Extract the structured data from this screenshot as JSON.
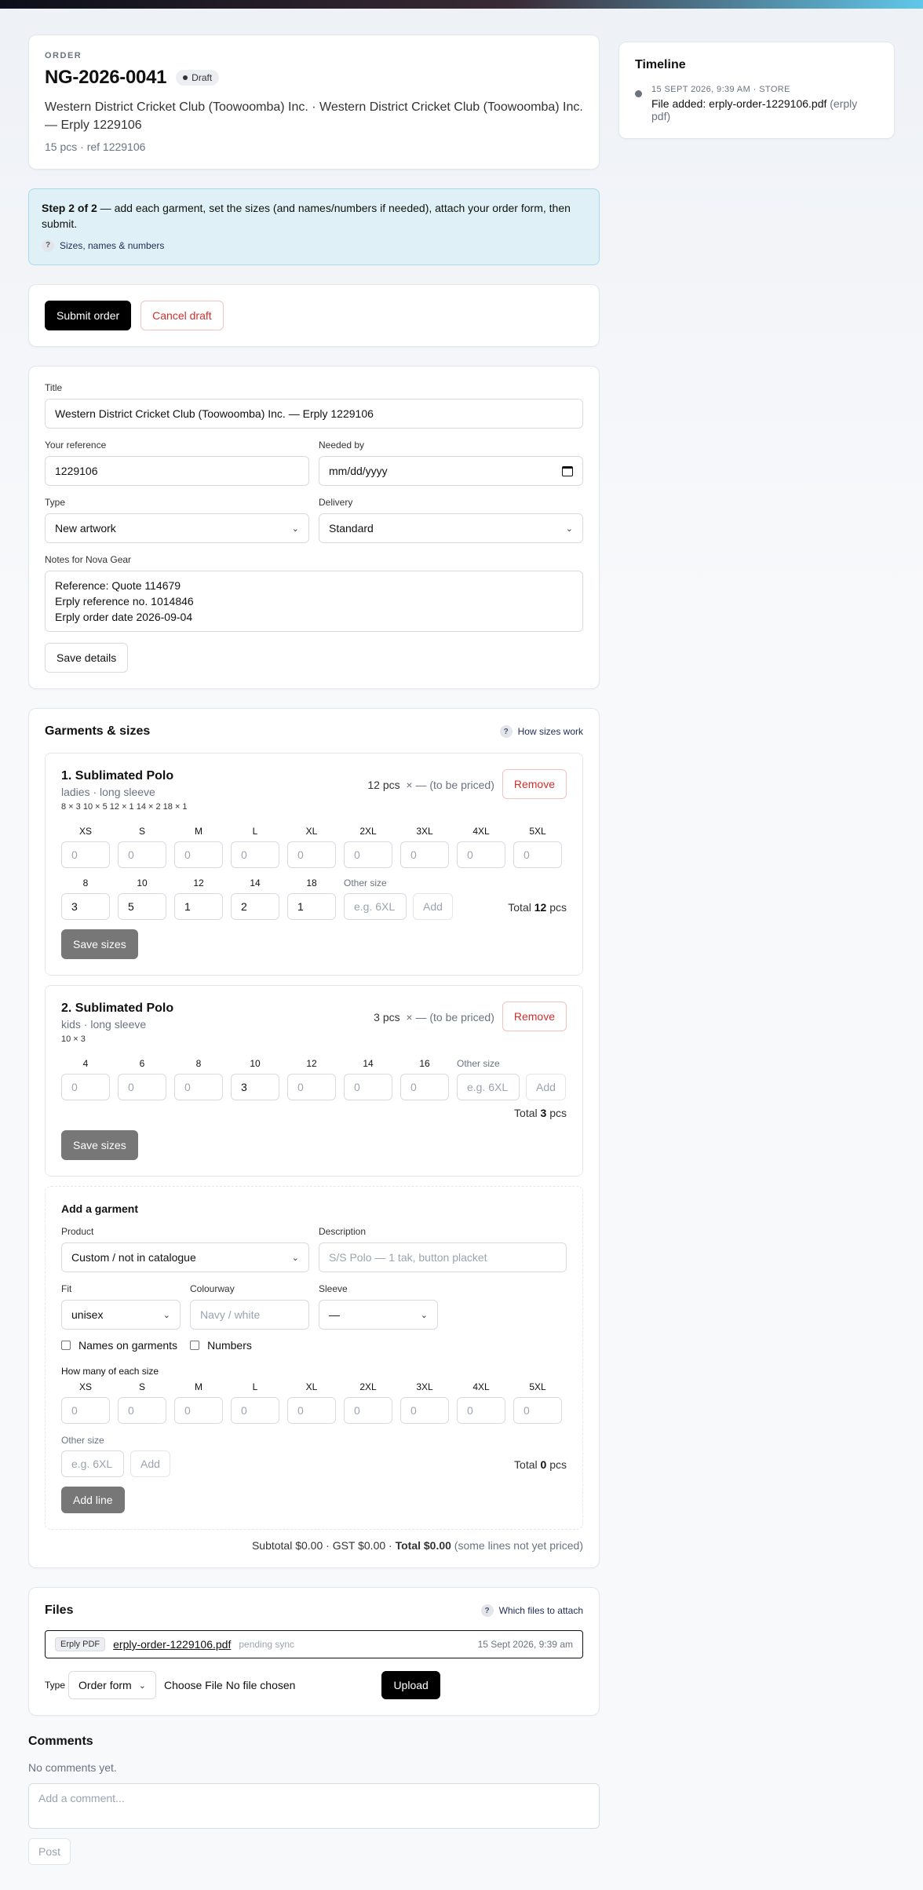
{
  "header": {
    "eyebrow": "ORDER",
    "order_no": "NG-2026-0041",
    "status": "Draft",
    "subtitle": "Western District Cricket Club (Toowoomba) Inc. · Western District Cricket Club (Toowoomba) Inc. — Erply 1229106",
    "meta": "15 pcs · ref 1229106"
  },
  "step": {
    "bold": "Step 2 of 2",
    "text": " — add each garment, set the sizes (and names/numbers if needed), attach your order form, then submit.",
    "help": "Sizes, names & numbers"
  },
  "actions": {
    "submit": "Submit order",
    "cancel": "Cancel draft"
  },
  "details": {
    "title_label": "Title",
    "title_value": "Western District Cricket Club (Toowoomba) Inc. — Erply 1229106",
    "ref_label": "Your reference",
    "ref_value": "1229106",
    "needed_label": "Needed by",
    "needed_placeholder": "mm/dd/yyyy",
    "type_label": "Type",
    "type_value": "New artwork",
    "delivery_label": "Delivery",
    "delivery_value": "Standard",
    "notes_label": "Notes for Nova Gear",
    "notes_value": "Reference: Quote 114679\nErply reference no. 1014846\nErply order date 2026-09-04",
    "save": "Save details"
  },
  "garments": {
    "title": "Garments & sizes",
    "help": "How sizes work",
    "items": [
      {
        "name": "1. Sublimated Polo",
        "sub": "ladies · long sleeve",
        "summary": "8 × 3 10 × 5 12 × 1 14 × 2 18 × 1",
        "qty": "12 pcs",
        "price": "× — (to be priced)",
        "remove": "Remove",
        "sizes": [
          {
            "label": "XS",
            "value": "0",
            "set": false
          },
          {
            "label": "S",
            "value": "0",
            "set": false
          },
          {
            "label": "M",
            "value": "0",
            "set": false
          },
          {
            "label": "L",
            "value": "0",
            "set": false
          },
          {
            "label": "XL",
            "value": "0",
            "set": false
          },
          {
            "label": "2XL",
            "value": "0",
            "set": false
          },
          {
            "label": "3XL",
            "value": "0",
            "set": false
          },
          {
            "label": "4XL",
            "value": "0",
            "set": false
          },
          {
            "label": "5XL",
            "value": "0",
            "set": false
          }
        ],
        "extra_sizes": [
          {
            "label": "8",
            "value": "3"
          },
          {
            "label": "10",
            "value": "5"
          },
          {
            "label": "12",
            "value": "1"
          },
          {
            "label": "14",
            "value": "2"
          },
          {
            "label": "18",
            "value": "1"
          }
        ],
        "other_label": "Other size",
        "other_placeholder": "e.g. 6XL",
        "add": "Add",
        "total_label": "Total",
        "total_value": "12",
        "total_unit": "pcs",
        "save": "Save sizes"
      },
      {
        "name": "2. Sublimated Polo",
        "sub": "kids · long sleeve",
        "summary": "10 × 3",
        "qty": "3 pcs",
        "price": "× — (to be priced)",
        "remove": "Remove",
        "sizes": [
          {
            "label": "4",
            "value": "0",
            "set": false
          },
          {
            "label": "6",
            "value": "0",
            "set": false
          },
          {
            "label": "8",
            "value": "0",
            "set": false
          },
          {
            "label": "10",
            "value": "3",
            "set": true
          },
          {
            "label": "12",
            "value": "0",
            "set": false
          },
          {
            "label": "14",
            "value": "0",
            "set": false
          },
          {
            "label": "16",
            "value": "0",
            "set": false
          }
        ],
        "other_label": "Other size",
        "other_placeholder": "e.g. 6XL",
        "add": "Add",
        "total_label": "Total",
        "total_value": "3",
        "total_unit": "pcs",
        "save": "Save sizes"
      }
    ],
    "add_form": {
      "title": "Add a garment",
      "product_label": "Product",
      "product_value": "Custom / not in catalogue",
      "desc_label": "Description",
      "desc_placeholder": "S/S Polo — 1 tak, button placket",
      "fit_label": "Fit",
      "fit_value": "unisex",
      "colour_label": "Colourway",
      "colour_placeholder": "Navy / white",
      "sleeve_label": "Sleeve",
      "sleeve_value": "—",
      "names_label": "Names on garments",
      "numbers_label": "Numbers",
      "qty_label": "How many of each size",
      "sizes": [
        "XS",
        "S",
        "M",
        "L",
        "XL",
        "2XL",
        "3XL",
        "4XL",
        "5XL"
      ],
      "size_placeholder": "0",
      "other_label": "Other size",
      "other_placeholder": "e.g. 6XL",
      "add": "Add",
      "total_label": "Total",
      "total_value": "0",
      "total_unit": "pcs",
      "add_line": "Add line"
    },
    "subtotal": "Subtotal $0.00 · GST $0.00 · ",
    "total": "Total $0.00",
    "note": " (some lines not yet priced)"
  },
  "files": {
    "title": "Files",
    "help": "Which files to attach",
    "item": {
      "tag": "Erply PDF",
      "name": "erply-order-1229106.pdf",
      "status": "pending sync",
      "date": "15 Sept 2026, 9:39 am"
    },
    "type_label": "Type",
    "type_value": "Order form",
    "choose": "Choose File",
    "no_file": "No file chosen",
    "upload": "Upload"
  },
  "comments": {
    "title": "Comments",
    "empty": "No comments yet.",
    "placeholder": "Add a comment...",
    "post": "Post"
  },
  "timeline": {
    "title": "Timeline",
    "items": [
      {
        "meta": "15 SEPT 2026, 9:39 AM · STORE",
        "text": "File added: erply-order-1229106.pdf",
        "detail": "(erply pdf)"
      }
    ]
  }
}
